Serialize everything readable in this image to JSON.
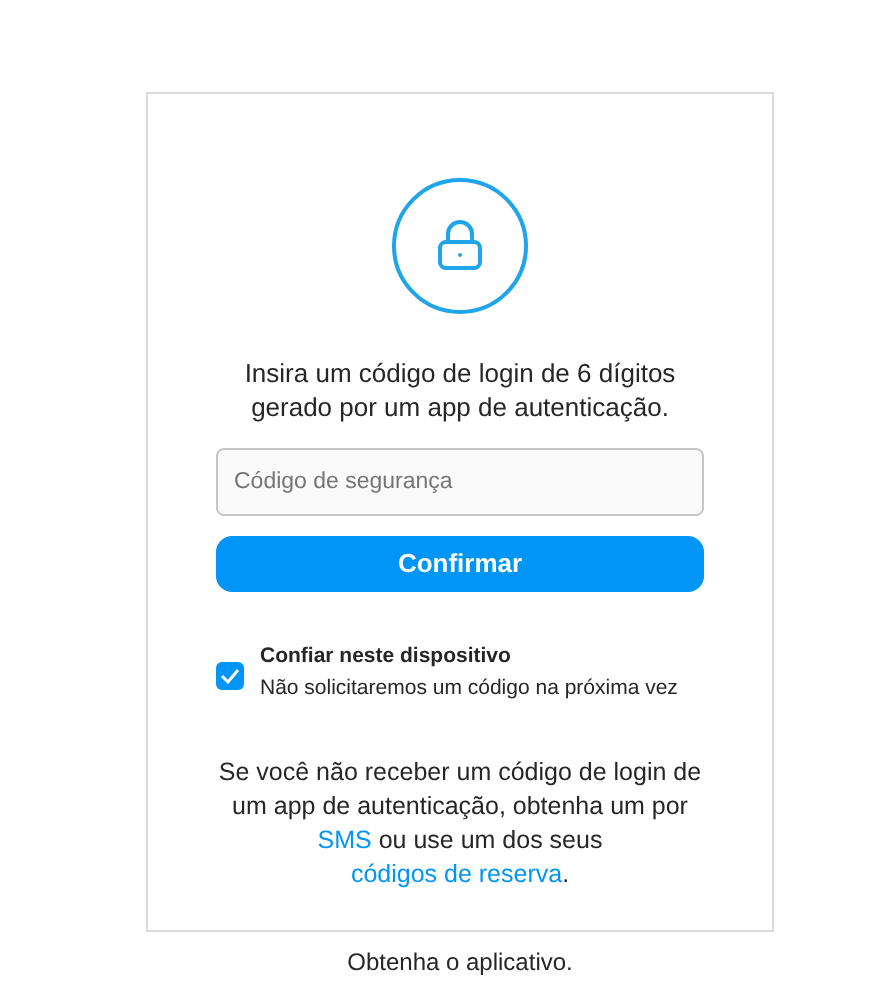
{
  "instruction": "Insira um código de login de 6 dígitos gerado por um app de autenticação.",
  "code_field": {
    "placeholder": "Código de segurança"
  },
  "confirm_button": "Confirmar",
  "trust_device": {
    "label": "Confiar neste dispositivo",
    "hint": "Não solicitaremos um código na próxima vez",
    "checked": true
  },
  "help": {
    "text_1": "Se você não receber um código de login de um app de autenticação, obtenha um por ",
    "link_1": "SMS",
    "text_2": " ou use um dos seus ",
    "link_2": "códigos de reserva",
    "text_3": "."
  },
  "footer": "Obtenha o aplicativo."
}
